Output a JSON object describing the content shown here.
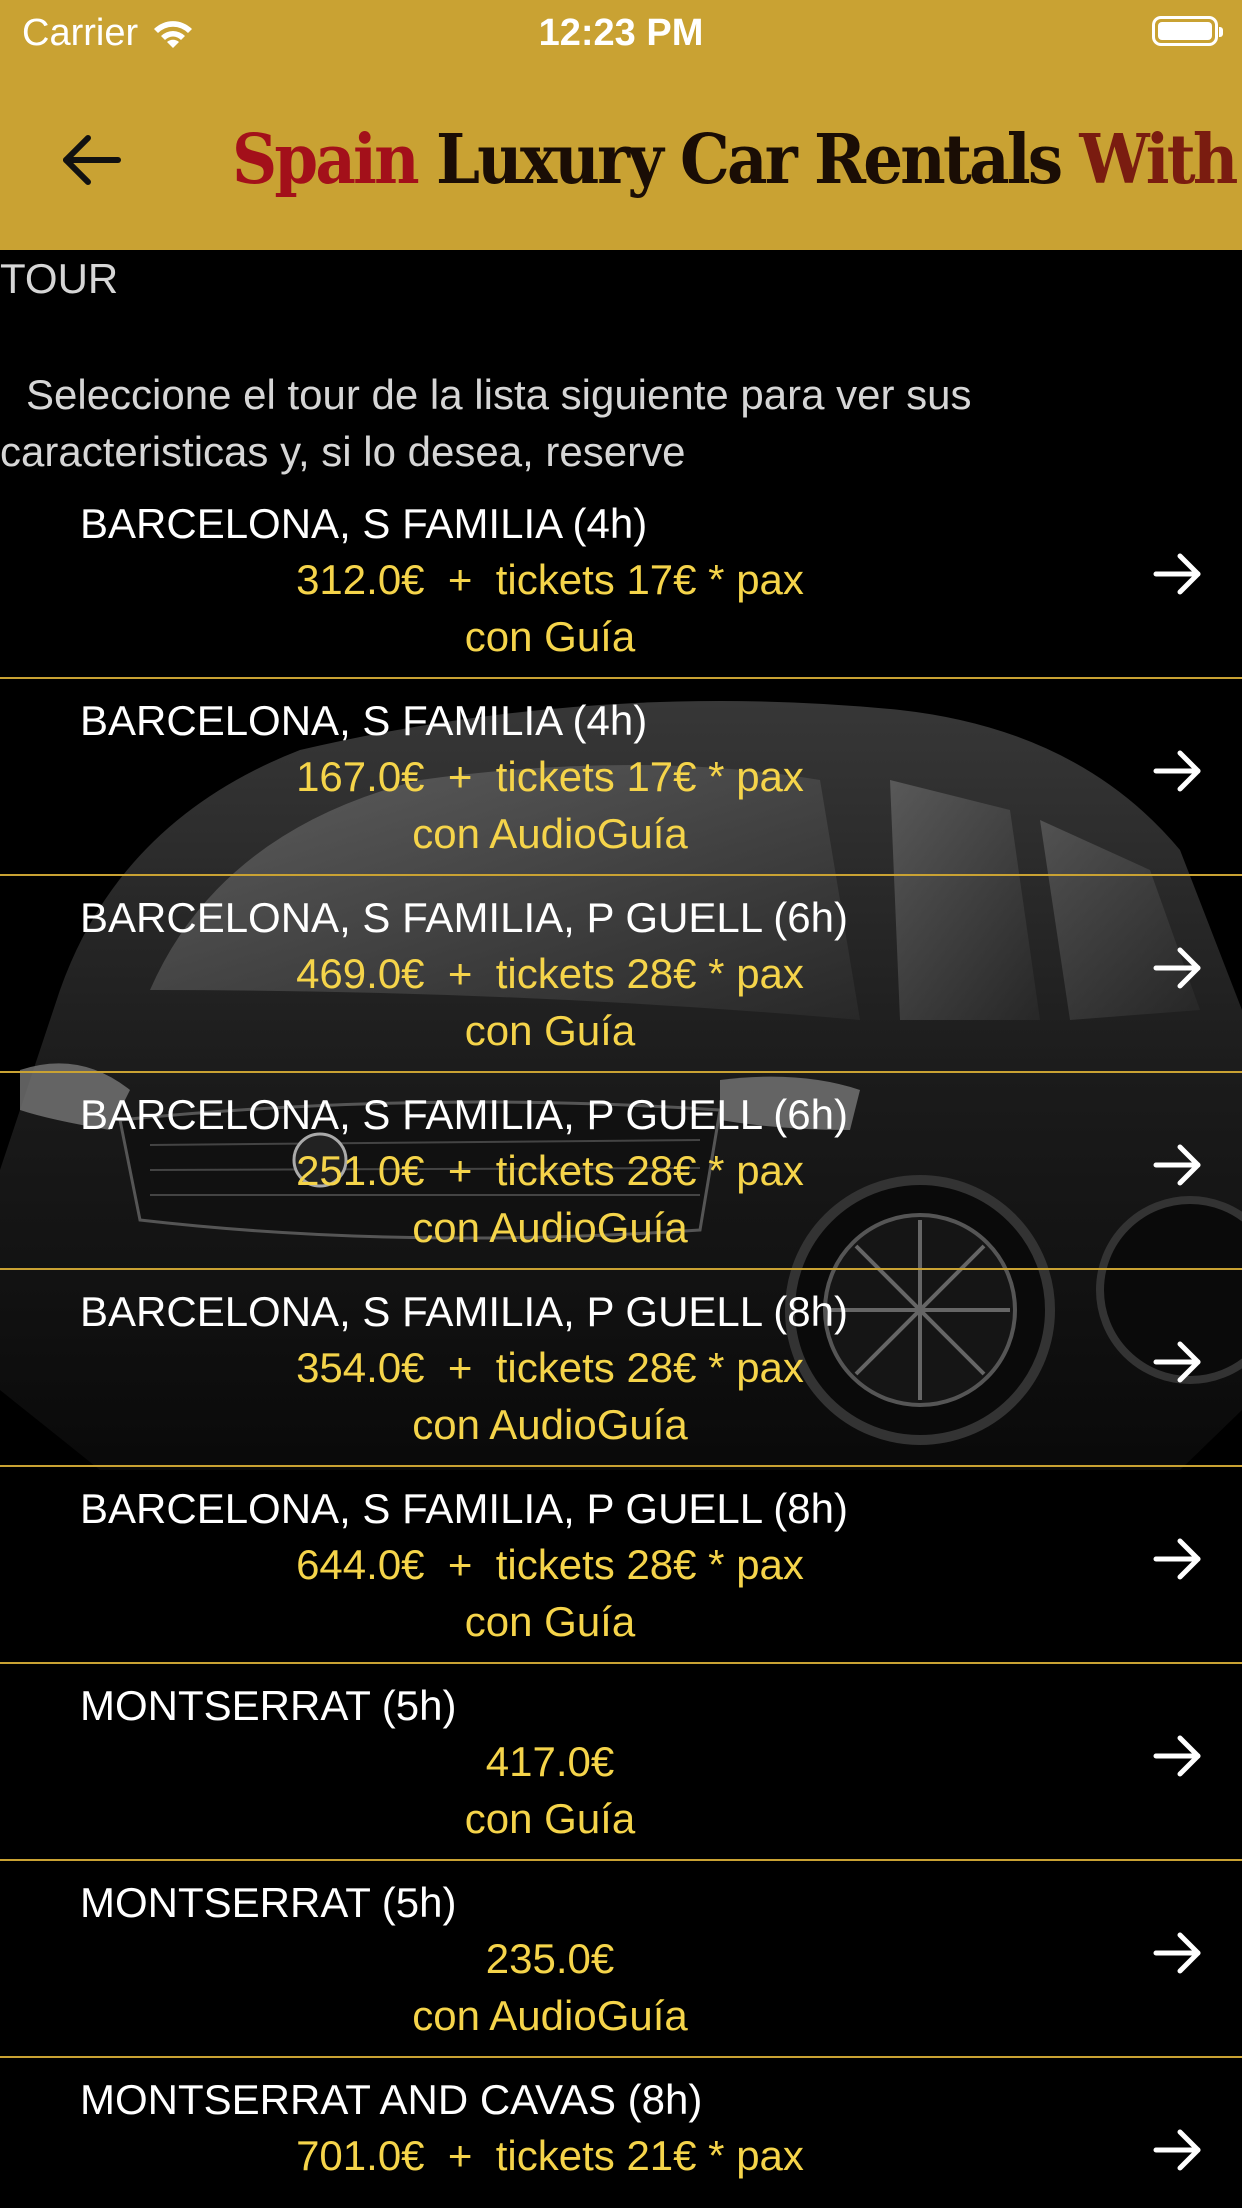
{
  "status_bar": {
    "carrier": "Carrier",
    "time": "12:23 PM"
  },
  "header": {
    "title_part1": "Spain",
    "title_part2": " Luxury Car Rentals ",
    "title_part3": "With Driver",
    "back_icon": "arrow-left-icon"
  },
  "section_label": "TOUR",
  "intro_text": "Seleccione el tour de la lista siguiente para ver sus caracteristicas y, si lo desea, reserve",
  "colors": {
    "header_bg": "#c9a233",
    "price_text": "#f5d44a",
    "divider": "#c9a233"
  },
  "tours": [
    {
      "name": "BARCELONA, S FAMILIA (4h)",
      "price": "312.0€  +  tickets 17€ * pax",
      "guide": "con Guía"
    },
    {
      "name": "BARCELONA, S FAMILIA (4h)",
      "price": "167.0€  +  tickets 17€ * pax",
      "guide": "con AudioGuía"
    },
    {
      "name": "BARCELONA, S FAMILIA, P GUELL (6h)",
      "price": "469.0€  +  tickets 28€ * pax",
      "guide": "con Guía"
    },
    {
      "name": "BARCELONA, S FAMILIA, P GUELL (6h)",
      "price": "251.0€  +  tickets 28€ * pax",
      "guide": "con AudioGuía"
    },
    {
      "name": "BARCELONA, S FAMILIA, P GUELL (8h)",
      "price": "354.0€  +  tickets 28€ * pax",
      "guide": "con AudioGuía"
    },
    {
      "name": "BARCELONA, S FAMILIA, P GUELL (8h)",
      "price": "644.0€  +  tickets 28€ * pax",
      "guide": "con Guía"
    },
    {
      "name": "MONTSERRAT (5h)",
      "price": "417.0€",
      "guide": "con Guía"
    },
    {
      "name": "MONTSERRAT (5h)",
      "price": "235.0€",
      "guide": "con AudioGuía"
    },
    {
      "name": "MONTSERRAT AND CAVAS (8h)",
      "price": "701.0€  +  tickets 21€ * pax",
      "guide": ""
    }
  ]
}
